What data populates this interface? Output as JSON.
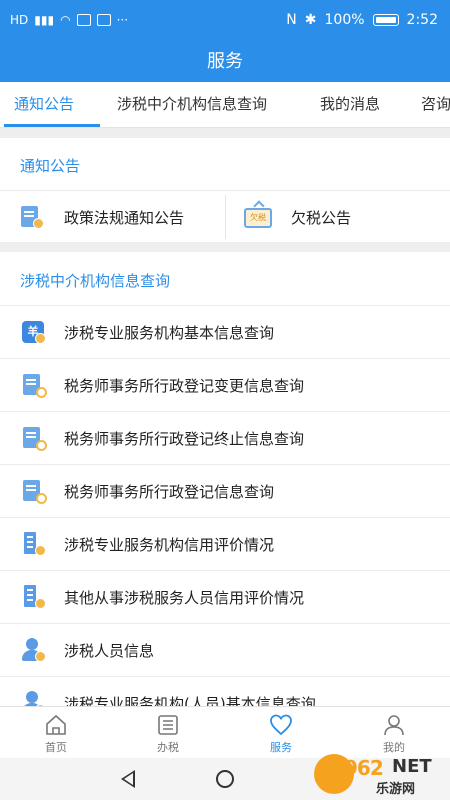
{
  "status_bar": {
    "left_text": "HD",
    "battery": "100%",
    "time": "2:52"
  },
  "header": {
    "title": "服务"
  },
  "tabs": [
    {
      "label": "通知公告",
      "active": true
    },
    {
      "label": "涉税中介机构信息查询",
      "active": false
    },
    {
      "label": "我的消息",
      "active": false
    },
    {
      "label": "咨询",
      "active": false
    }
  ],
  "notice_section": {
    "title": "通知公告",
    "items": [
      {
        "label": "政策法规通知公告",
        "icon": "document-star-icon"
      },
      {
        "label": "欠税公告",
        "icon": "tax-arrears-sign-icon",
        "icon_text": "欠税"
      }
    ]
  },
  "query_section": {
    "title": "涉税中介机构信息查询",
    "items": [
      {
        "label": "涉税专业服务机构基本信息查询",
        "icon": "agency-info-icon",
        "icon_text": "羊"
      },
      {
        "label": "税务师事务所行政登记变更信息查询",
        "icon": "document-search-icon"
      },
      {
        "label": "税务师事务所行政登记终止信息查询",
        "icon": "document-search-icon"
      },
      {
        "label": "税务师事务所行政登记信息查询",
        "icon": "document-search-icon"
      },
      {
        "label": "涉税专业服务机构信用评价情况",
        "icon": "building-credit-icon"
      },
      {
        "label": "其他从事涉税服务人员信用评价情况",
        "icon": "building-credit-icon"
      },
      {
        "label": "涉税人员信息",
        "icon": "person-icon"
      },
      {
        "label": "涉税专业服务机构(人员)基本信息查询",
        "icon": "person-icon"
      }
    ]
  },
  "bottom_nav": [
    {
      "label": "首页",
      "icon": "home-icon",
      "active": false
    },
    {
      "label": "办税",
      "icon": "list-icon",
      "active": false
    },
    {
      "label": "服务",
      "icon": "heart-icon",
      "active": true
    },
    {
      "label": "我的",
      "icon": "user-icon",
      "active": false
    }
  ],
  "watermark": {
    "number": "962",
    "net": "NET",
    "site": "乐游网"
  },
  "colors": {
    "accent": "#2b8ee8",
    "icon_blue": "#5b9be6",
    "icon_gold": "#f2b84a"
  }
}
